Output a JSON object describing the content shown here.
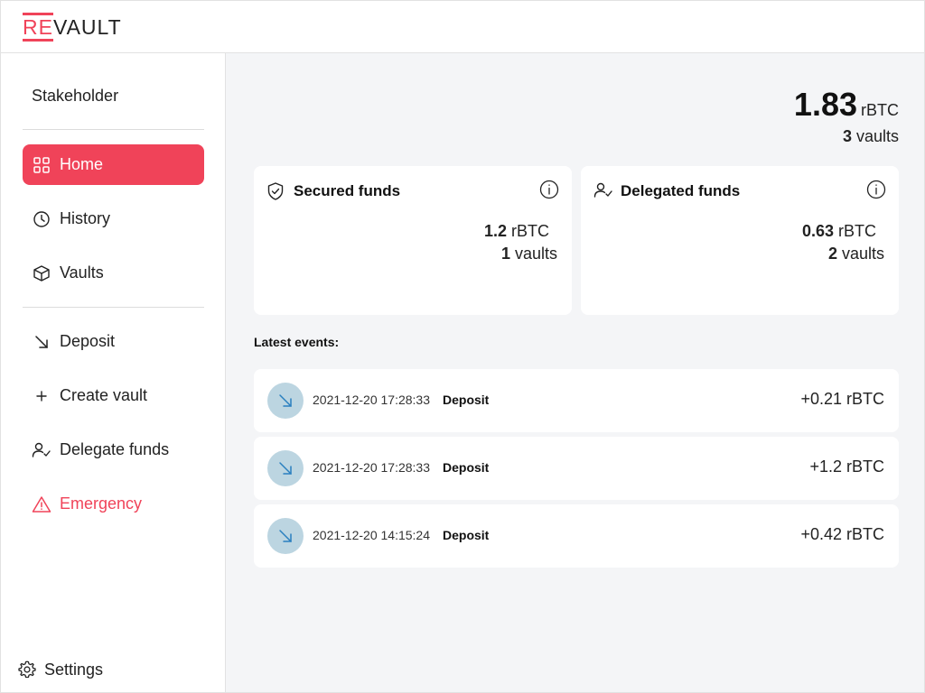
{
  "header": {
    "logo_prefix": "RE",
    "logo_suffix": "VAULT",
    "brand_color": "#f04359"
  },
  "sidebar": {
    "role": "Stakeholder",
    "items": [
      {
        "label": "Home",
        "icon": "grid-icon",
        "active": true
      },
      {
        "label": "History",
        "icon": "clock-icon"
      },
      {
        "label": "Vaults",
        "icon": "box-icon"
      },
      {
        "label": "Deposit",
        "icon": "arrow-down-right-icon"
      },
      {
        "label": "Create vault",
        "icon": "plus-icon"
      },
      {
        "label": "Delegate funds",
        "icon": "user-check-icon"
      },
      {
        "label": "Emergency",
        "icon": "warning-icon",
        "danger": true
      }
    ],
    "settings_label": "Settings"
  },
  "main": {
    "total": {
      "amount": "1.83",
      "unit": "rBTC",
      "vaults_count": "3",
      "vaults_label": "vaults"
    },
    "cards": [
      {
        "title": "Secured funds",
        "icon": "shield-check-icon",
        "amount": "1.2",
        "unit": "rBTC",
        "vaults_count": "1",
        "vaults_label": "vaults"
      },
      {
        "title": "Delegated funds",
        "icon": "user-check-icon",
        "amount": "0.63",
        "unit": "rBTC",
        "vaults_count": "2",
        "vaults_label": "vaults"
      }
    ],
    "events_label": "Latest events:",
    "events": [
      {
        "date": "2021-12-20 17:28:33",
        "type": "Deposit",
        "amount": "+0.21 rBTC"
      },
      {
        "date": "2021-12-20 17:28:33",
        "type": "Deposit",
        "amount": "+1.2 rBTC"
      },
      {
        "date": "2021-12-20 14:15:24",
        "type": "Deposit",
        "amount": "+0.42 rBTC"
      }
    ]
  }
}
